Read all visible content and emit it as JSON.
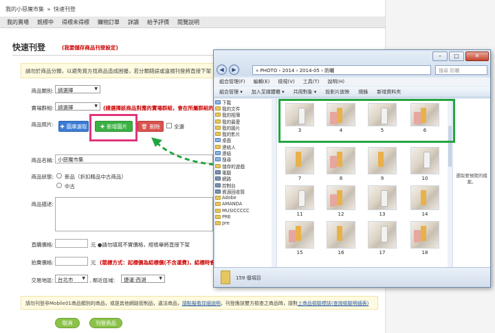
{
  "breadcrumb": [
    "我的小惡魔市集",
    "»",
    "快速刊登"
  ],
  "nav_tabs": [
    "我的賣場",
    "競標中",
    "得標未得標",
    "購物訂單",
    "詳讀",
    "給予評價",
    "閱覽說明"
  ],
  "page_title": "快速刊登",
  "title_note": "(我要儲存商品刊登設定)",
  "notice_top": "請勿於商品分類，以避免買方找商品造成困擾，若分類錯誤或違規刊登將直接下架",
  "form": {
    "category_label": "商品類別:",
    "category_value": "請選擇",
    "store_label": "賣場群組:",
    "store_value": "請選擇",
    "store_hint": "(請選擇該商品對應的賣場群組，會在所屬群組的商品",
    "photo_label": "商品照片:",
    "btn_upload": "圖庫選取",
    "btn_add": "新增圖片",
    "btn_delete": "刪除",
    "select_all": "全選",
    "name_label": "商品名稱:",
    "name_value": "小惡魔市集",
    "status_label": "商品狀態:",
    "status_new": "新品（折扣精品中古商品）",
    "status_used": "中古",
    "desc_label": "商品描述:",
    "price_label": "直購價格:",
    "price_hint": "元 ●請勿填寫不實價格，經檢舉將直接下架",
    "bid_label": "拍賣價格:",
    "bid_hint": "元",
    "bid_red": "(競標方式：起標價為結標價(不含運費)，結標時會以最高",
    "trade_label": "交易地區:",
    "trade_city": "台北市",
    "trade_area_label": ", 鄰近區域:",
    "trade_area": "捷運:西湖"
  },
  "notice_bottom_pre": "請勿刊登非Mobile01商品類別的商品，或是其他網路管制品，違法商品，",
  "notice_bottom_link1": "請點擬看詳細說明",
  "notice_bottom_mid": "，刊登應該雙方檢查之商品時，請對",
  "notice_bottom_link2": "上商品檢驗標誌",
  "notice_bottom_link3": "(查詢檢驗明細表)",
  "btn_cancel": "取消",
  "btn_submit": "刊登商品",
  "explorer": {
    "address": "«  PHOTO  ›  2014  ›  2014-05  ›  防曬",
    "search_placeholder": "搜尋 防曬",
    "menu": [
      "組合管理(F)",
      "編輯(E)",
      "檢視(V)",
      "工具(T)",
      "說明(H)"
    ],
    "toolbar": [
      "組合管理 ▾",
      "加入至媒體櫃 ▾",
      "共用對象 ▾",
      "投影片放映",
      "燒錄",
      "新增資料夾"
    ],
    "tree": [
      "下載",
      "我的文件",
      "我的相簿",
      "我的最愛",
      "我的圖片",
      "我的影片",
      "桌面",
      "連絡人",
      "連結",
      "搜尋",
      "儲存的遊戲",
      "電腦",
      "網路",
      "控制台",
      "資源回收筒",
      "Adobe",
      "AMANDA",
      "MUSICCCCC",
      "PRE",
      "pre"
    ],
    "thumbs_row1": [
      "3",
      "4",
      "5",
      "6"
    ],
    "thumbs_row2": [
      "7",
      "8",
      "9",
      "10"
    ],
    "thumbs_row3": [
      "11",
      "12",
      "13",
      "14"
    ],
    "thumbs_row4": [
      "15",
      "16",
      "17",
      "18"
    ],
    "preview_text": "選取要預覽的檔案。",
    "status": "159 個項目"
  }
}
